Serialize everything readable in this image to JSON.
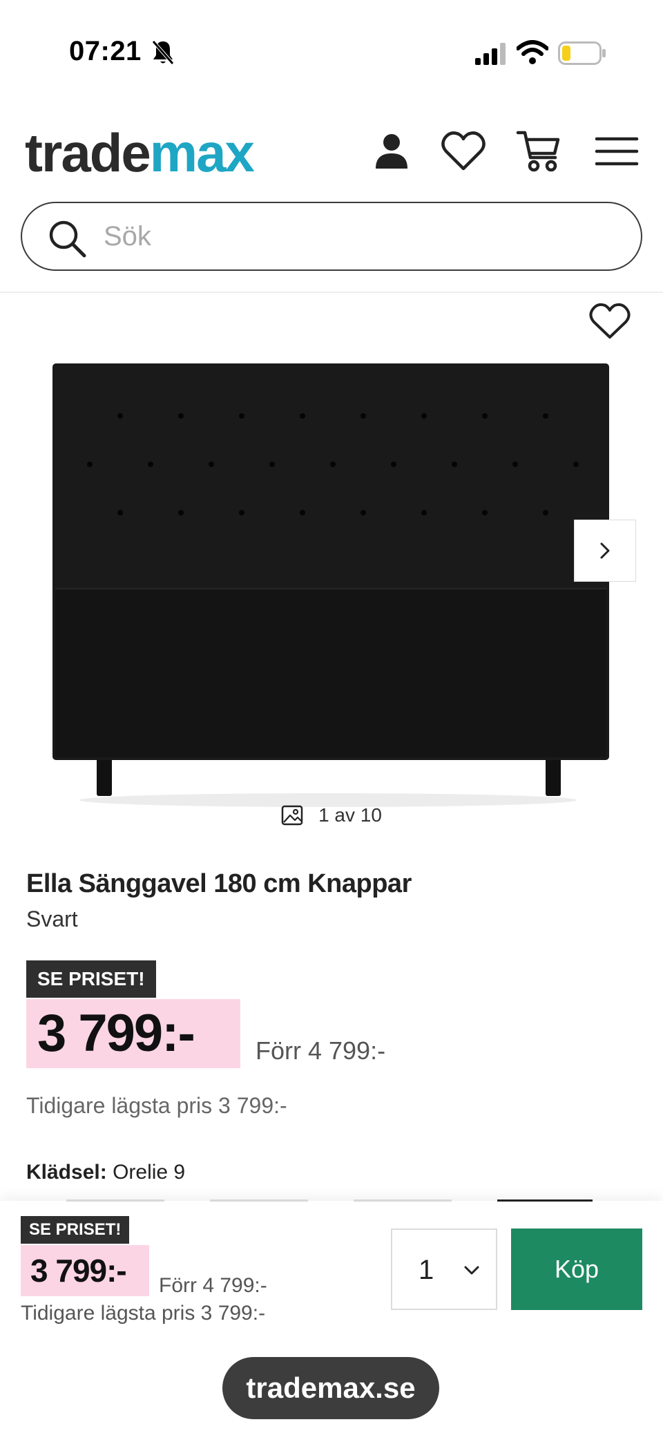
{
  "status_bar": {
    "time": "07:21",
    "icons": [
      "bell-slash-icon",
      "signal-icon",
      "wifi-icon",
      "battery-icon"
    ]
  },
  "header": {
    "logo_part1": "trade",
    "logo_part2": "max",
    "icons": [
      "user-icon",
      "heart-icon",
      "cart-icon",
      "menu-icon"
    ],
    "colors": {
      "logo_dark": "#2b2b2b",
      "logo_accent": "#1ea6c4"
    }
  },
  "search": {
    "placeholder": "Sök",
    "value": ""
  },
  "gallery": {
    "counter": "1 av 10"
  },
  "product": {
    "title": "Ella Sänggavel 180 cm Knappar",
    "variant": "Svart",
    "badge": "SE PRISET!",
    "price": "3 799:-",
    "price_before": "Förr 4 799:-",
    "lowest_price": "Tidigare lägsta pris 3 799:-",
    "upholstery_label": "Klädsel:",
    "upholstery_value": "Orelie 9"
  },
  "buy_bar": {
    "badge": "SE PRISET!",
    "price": "3 799:-",
    "price_before": "Förr 4 799:-",
    "lowest_price": "Tidigare lägsta pris 3 799:-",
    "quantity": "1",
    "buy_label": "Köp",
    "colors": {
      "buy_button": "#1d8a62",
      "price_highlight": "#fcd5e4",
      "badge_bg": "#2f2f2f"
    }
  },
  "browser": {
    "url": "trademax.se"
  }
}
